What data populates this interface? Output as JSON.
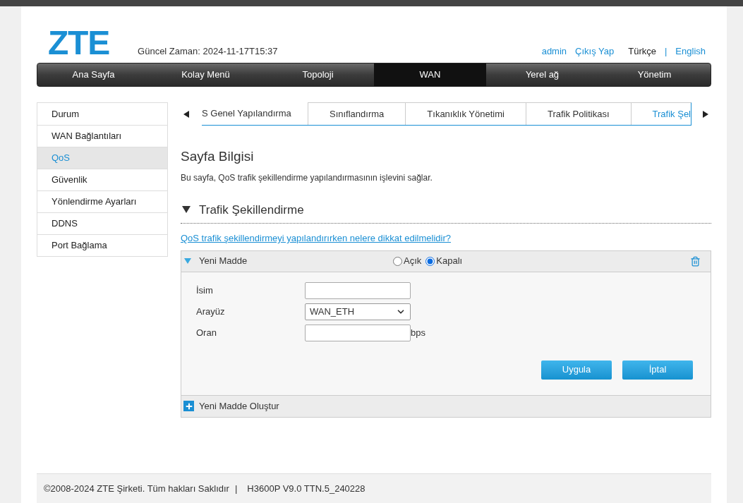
{
  "header": {
    "logo": "ZTE",
    "time_label": "Güncel Zaman: 2024-11-17T15:37",
    "user": "admin",
    "logout": "Çıkış Yap",
    "languages": [
      {
        "label": "Türkçe",
        "selected": true
      },
      {
        "label": "English",
        "selected": false
      }
    ],
    "separator": "|"
  },
  "nav": [
    {
      "label": "Ana Sayfa",
      "selected": false
    },
    {
      "label": "Kolay Menü",
      "selected": false
    },
    {
      "label": "Topoloji",
      "selected": false
    },
    {
      "label": "WAN",
      "selected": true
    },
    {
      "label": "Yerel ağ",
      "selected": false
    },
    {
      "label": "Yönetim",
      "selected": false
    }
  ],
  "sidebar": {
    "items": [
      {
        "label": "Durum",
        "selected": false
      },
      {
        "label": "WAN Bağlantıları",
        "selected": false
      },
      {
        "label": "QoS",
        "selected": true
      },
      {
        "label": "Güvenlik",
        "selected": false
      },
      {
        "label": "Yönlendirme Ayarları",
        "selected": false
      },
      {
        "label": "DDNS",
        "selected": false
      },
      {
        "label": "Port Bağlama",
        "selected": false
      }
    ]
  },
  "tabs": [
    {
      "label": "S Genel Yapılandırma",
      "selected": false
    },
    {
      "label": "Sınıflandırma",
      "selected": false
    },
    {
      "label": "Tıkanıklık Yönetimi",
      "selected": false
    },
    {
      "label": "Trafik Politikası",
      "selected": false
    },
    {
      "label": "Trafik Şel",
      "selected": true
    }
  ],
  "page_info": {
    "title": "Sayfa Bilgisi",
    "description": "Bu sayfa, QoS trafik şekillendirme yapılandırmasının işlevini sağlar."
  },
  "section": {
    "title": "Trafik Şekillendirme",
    "expanded": true,
    "help_link": "QoS trafik şekillendirmeyi yapılandırırken nelere dikkat edilmelidir?",
    "item": {
      "title": "Yeni Madde",
      "expanded": true,
      "options": [
        {
          "label": "Açık",
          "selected": false
        },
        {
          "label": "Kapalı",
          "selected": true
        }
      ],
      "fields": [
        {
          "kind": "text",
          "label": "İsim"
        },
        {
          "kind": "select",
          "label": "Arayüz",
          "value": "WAN_ETH"
        },
        {
          "kind": "text",
          "label": "Oran",
          "unit": "bps"
        }
      ],
      "buttons": [
        "Uygula",
        "İptal"
      ]
    },
    "add_label": "Yeni Madde Oluştur"
  },
  "footer": {
    "copyright": "©2008-2024 ZTE Şirketi. Tüm hakları Saklıdır",
    "separator": "|",
    "version": "H3600P V9.0 TTN.5_240228"
  }
}
